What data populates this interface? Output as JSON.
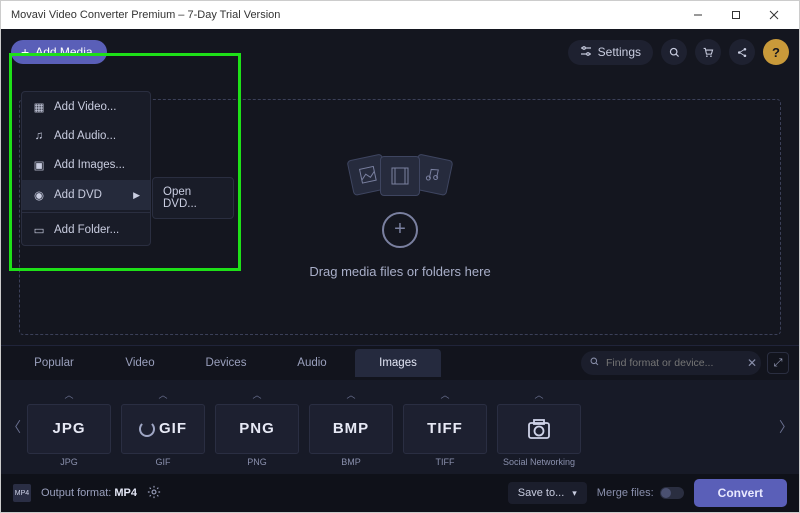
{
  "window": {
    "title": "Movavi Video Converter Premium – 7-Day Trial Version"
  },
  "toolbar": {
    "add_media": "Add Media",
    "settings": "Settings"
  },
  "menu": {
    "add_video": "Add Video...",
    "add_audio": "Add Audio...",
    "add_images": "Add Images...",
    "add_dvd": "Add DVD",
    "add_folder": "Add Folder...",
    "open_dvd": "Open DVD..."
  },
  "dropzone": {
    "text": "Drag media files or folders here"
  },
  "tabs": {
    "popular": "Popular",
    "video": "Video",
    "devices": "Devices",
    "audio": "Audio",
    "images": "Images"
  },
  "search": {
    "placeholder": "Find format or device..."
  },
  "formats": [
    {
      "logo": "JPG",
      "label": "JPG"
    },
    {
      "logo": "GIF",
      "label": "GIF"
    },
    {
      "logo": "PNG",
      "label": "PNG"
    },
    {
      "logo": "BMP",
      "label": "BMP"
    },
    {
      "logo": "TIFF",
      "label": "TIFF"
    },
    {
      "logo": "cam",
      "label": "Social Networking"
    }
  ],
  "bottom": {
    "output_label": "Output format:",
    "output_value": "MP4",
    "save_to": "Save to...",
    "merge": "Merge files:",
    "convert": "Convert"
  }
}
